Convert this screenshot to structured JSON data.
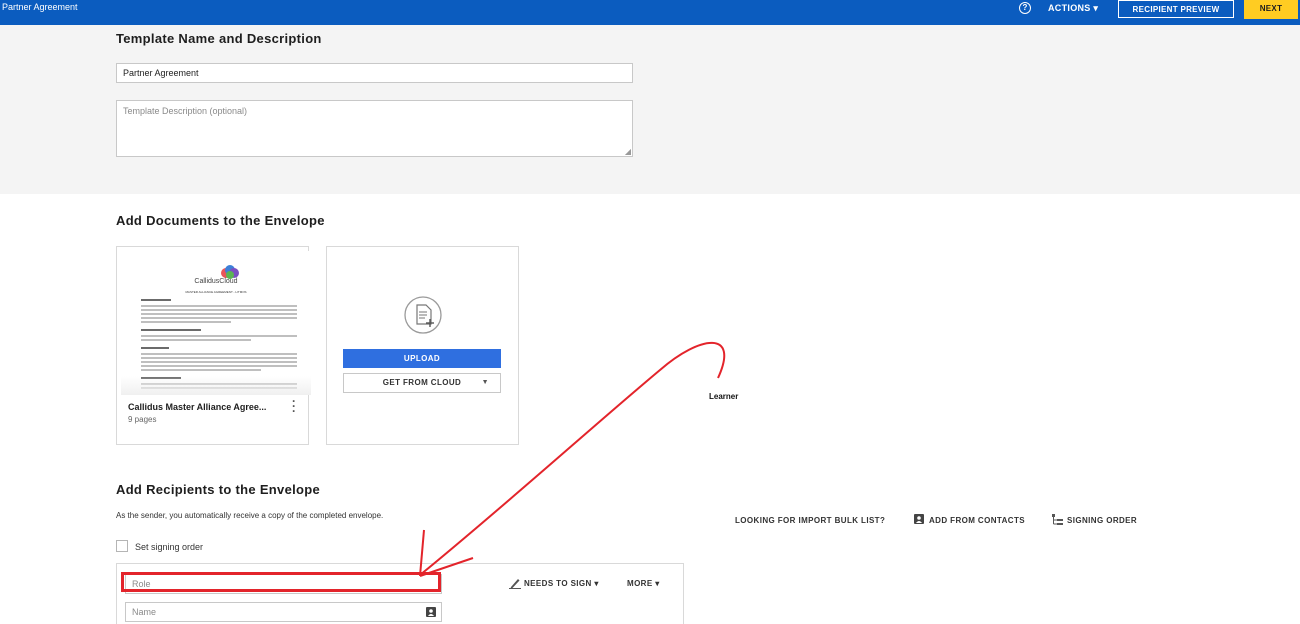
{
  "topbar": {
    "doc_title": "Partner Agreement",
    "help_icon": "question-circle-icon",
    "actions_label": "ACTIONS ▾",
    "recipient_preview_label": "RECIPIENT PREVIEW",
    "next_label": "NEXT",
    "color": "#0b5cbf",
    "next_color": "#ffcc22"
  },
  "template": {
    "heading": "Template Name and Description",
    "name_value": "Partner Agreement",
    "description_placeholder": "Template Description (optional)"
  },
  "documents": {
    "heading": "Add Documents to the Envelope",
    "doc_name": "Callidus Master Alliance Agree...",
    "doc_pages": "9 pages",
    "thumb_logo": "CallidusCloud",
    "thumb_subtitle": "MASTER ALLIANCE AGREEMENT - LITMOS",
    "upload_label": "UPLOAD",
    "cloud_label": "GET FROM CLOUD"
  },
  "recipients": {
    "heading": "Add Recipients to the Envelope",
    "sender_note": "As the sender, you automatically receive a copy of the completed envelope.",
    "signing_order_checkbox": "Set signing order",
    "import_bulk_label": "LOOKING FOR IMPORT BULK LIST?",
    "add_contacts_label": "ADD FROM CONTACTS",
    "signing_order_label": "SIGNING ORDER",
    "role_placeholder": "Role",
    "name_placeholder": "Name",
    "needs_to_sign_label": "NEEDS TO SIGN ▾",
    "more_label": "MORE ▾"
  },
  "annotation": {
    "label": "Learner",
    "color": "#e3242b"
  }
}
